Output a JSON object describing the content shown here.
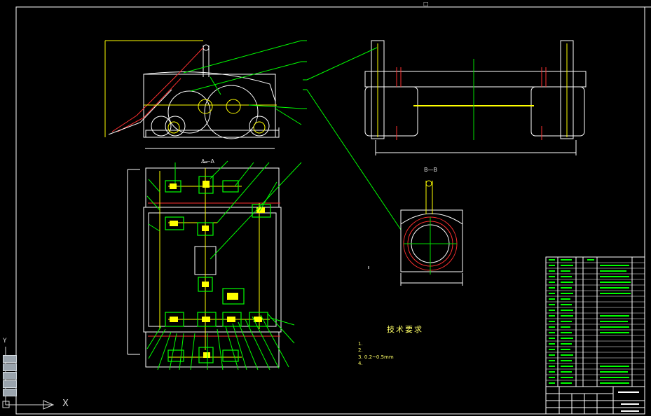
{
  "drawing": {
    "section_aa_label": "A—A",
    "section_bb_label": "B—B"
  },
  "technical_requirements": {
    "title": "技术要求",
    "items": [
      "1.",
      "2.",
      "3.                                        0.2~0.5mm",
      "4."
    ]
  },
  "axis_indicator": {
    "x_label": "X",
    "y_label": "Y"
  },
  "window": {
    "corner_glyph": "□"
  },
  "colors": {
    "background": "#000000",
    "outline": "#ffffff",
    "leader": "#00ff00",
    "part": "#ffff00",
    "centerline": "#ff3030",
    "dimension": "#00e000"
  }
}
